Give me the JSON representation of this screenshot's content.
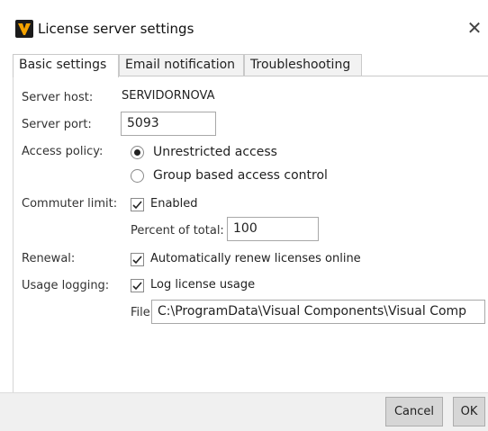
{
  "window": {
    "title": "License server settings",
    "close_glyph": "✕",
    "icon": "visual-components-logo-icon"
  },
  "tabs": [
    {
      "label": "Basic settings",
      "active": true
    },
    {
      "label": "Email notification",
      "active": false
    },
    {
      "label": "Troubleshooting",
      "active": false
    }
  ],
  "form": {
    "server_host": {
      "label": "Server host:",
      "value": "SERVIDORNOVA"
    },
    "server_port": {
      "label": "Server port:",
      "value": "5093"
    },
    "access_policy": {
      "label": "Access policy:",
      "options": [
        {
          "label": "Unrestricted access",
          "selected": true
        },
        {
          "label": "Group based access control",
          "selected": false
        }
      ]
    },
    "commuter_limit": {
      "label": "Commuter limit:",
      "enabled_label": "Enabled",
      "enabled_checked": true,
      "percent_label": "Percent of total:",
      "percent_value": "100"
    },
    "renewal": {
      "label": "Renewal:",
      "option_label": "Automatically renew licenses online",
      "checked": true
    },
    "usage_logging": {
      "label": "Usage logging:",
      "option_label": "Log license usage",
      "checked": true,
      "file_label": "File:",
      "file_value": "C:\\ProgramData\\Visual Components\\Visual Comp"
    }
  },
  "buttons": {
    "cancel": "Cancel",
    "ok": "OK"
  }
}
